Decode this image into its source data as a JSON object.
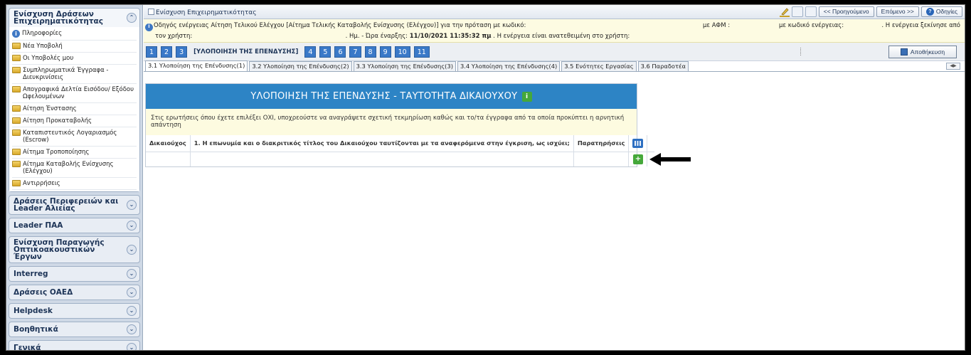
{
  "sidebar": {
    "open_group": {
      "title": "Ενίσχυση Δράσεων Επιχειρηματικότητας",
      "items": [
        {
          "label": "Πληροφορίες",
          "icon": "info-icon"
        },
        {
          "label": "Νέα Υποβολή",
          "icon": "folder-icon"
        },
        {
          "label": "Οι Υποβολές μου",
          "icon": "folder-icon"
        },
        {
          "label": "Συμπληρωματικά Έγγραφα - Διευκρινίσεις",
          "icon": "folder-icon"
        },
        {
          "label": "Απογραφικά Δελτία Εισόδου/ Εξόδου Ωφελουμένων",
          "icon": "folder-icon"
        },
        {
          "label": "Αίτηση Ένστασης",
          "icon": "folder-icon"
        },
        {
          "label": "Αίτηση Προκαταβολής",
          "icon": "folder-icon"
        },
        {
          "label": "Καταπιστευτικός Λογαριασμός (Escrow)",
          "icon": "folder-icon"
        },
        {
          "label": "Αίτημα Τροποποίησης",
          "icon": "folder-icon"
        },
        {
          "label": "Αίτημα Καταβολής Ενίσχυσης (Ελέγχου)",
          "icon": "folder-icon"
        },
        {
          "label": "Αντιρρήσεις",
          "icon": "folder-icon"
        }
      ]
    },
    "groups": [
      "Δράσεις Περιφερειών και Leader Αλιείας",
      "Leader ΠΑΑ",
      "Ενίσχυση Παραγωγής Οπτικοακουστικών Έργων",
      "Interreg",
      "Δράσεις ΟΑΕΔ",
      "Helpdesk",
      "Βοηθητικά",
      "Γενικά"
    ]
  },
  "topbar": {
    "title": "Ενίσχυση Επιχειρηματικότητας",
    "prev": "<< Προηγούμενο",
    "next": "Επόμενο >>",
    "help": "Οδηγίες"
  },
  "notice": {
    "line1": "Οδηγός ενέργειας Αίτηση Τελικού Ελέγχου [Αίτημα Τελικής Καταβολής Ενίσχυσης (Ελέγχου)] για την πρόταση με κωδικό:",
    "afm": "με ΑΦΜ :",
    "action_code": "με κωδικό ενέργειας:",
    "started": ". Η ενέργεια ξεκίνησε από",
    "line2_prefix": "τον χρήστη:",
    "line2_date_label": ". Ημ. - Ώρα έναρξης:",
    "line2_date": "11/10/2021 11:35:32 πμ",
    "line2_suffix": ". Η ενέργεια είναι ανατεθειμένη στο χρήστη:"
  },
  "steps": {
    "before": [
      "1",
      "2",
      "3"
    ],
    "current_label": "[ΥΛΟΠΟΙΗΣΗ ΤΗΣ ΕΠΕΝΔΥΣΗΣ]",
    "after": [
      "4",
      "5",
      "6",
      "7",
      "8",
      "9",
      "10",
      "11"
    ],
    "save": "Αποθήκευση"
  },
  "tabs": [
    "3.1 Υλοποίηση της Επένδυσης(1)",
    "3.2 Υλοποίηση της Επένδυσης(2)",
    "3.3 Υλοποίηση της Επένδυσης(3)",
    "3.4 Υλοποίηση της Επένδυσης(4)",
    "3.5 Ενότητες Εργασίας",
    "3.6 Παραδοτέα"
  ],
  "panel": {
    "title": "ΥΛΟΠΟΙΗΣΗ ΤΗΣ ΕΠΕΝΔΥΣΗΣ - ΤΑΥΤΟΤΗΤΑ ΔΙΚΑΙΟΥΧΟΥ",
    "instructions": "Στις ερωτήσεις όπου έχετε επιλέξει ΟΧΙ, υποχρεούστε να αναγράψετε σχετική τεκμηρίωση καθώς και το/τα έγγραφα από τα οποία προκύπτει η αρνητική απάντηση",
    "columns": [
      "Δικαιούχος",
      "1. Η επωνυμία και ο διακριτικός τίτλος του Δικαιούχου ταυτίζονται με τα αναφερόμενα στην έγκριση, ως ισχύει;",
      "Παρατηρήσεις"
    ]
  }
}
